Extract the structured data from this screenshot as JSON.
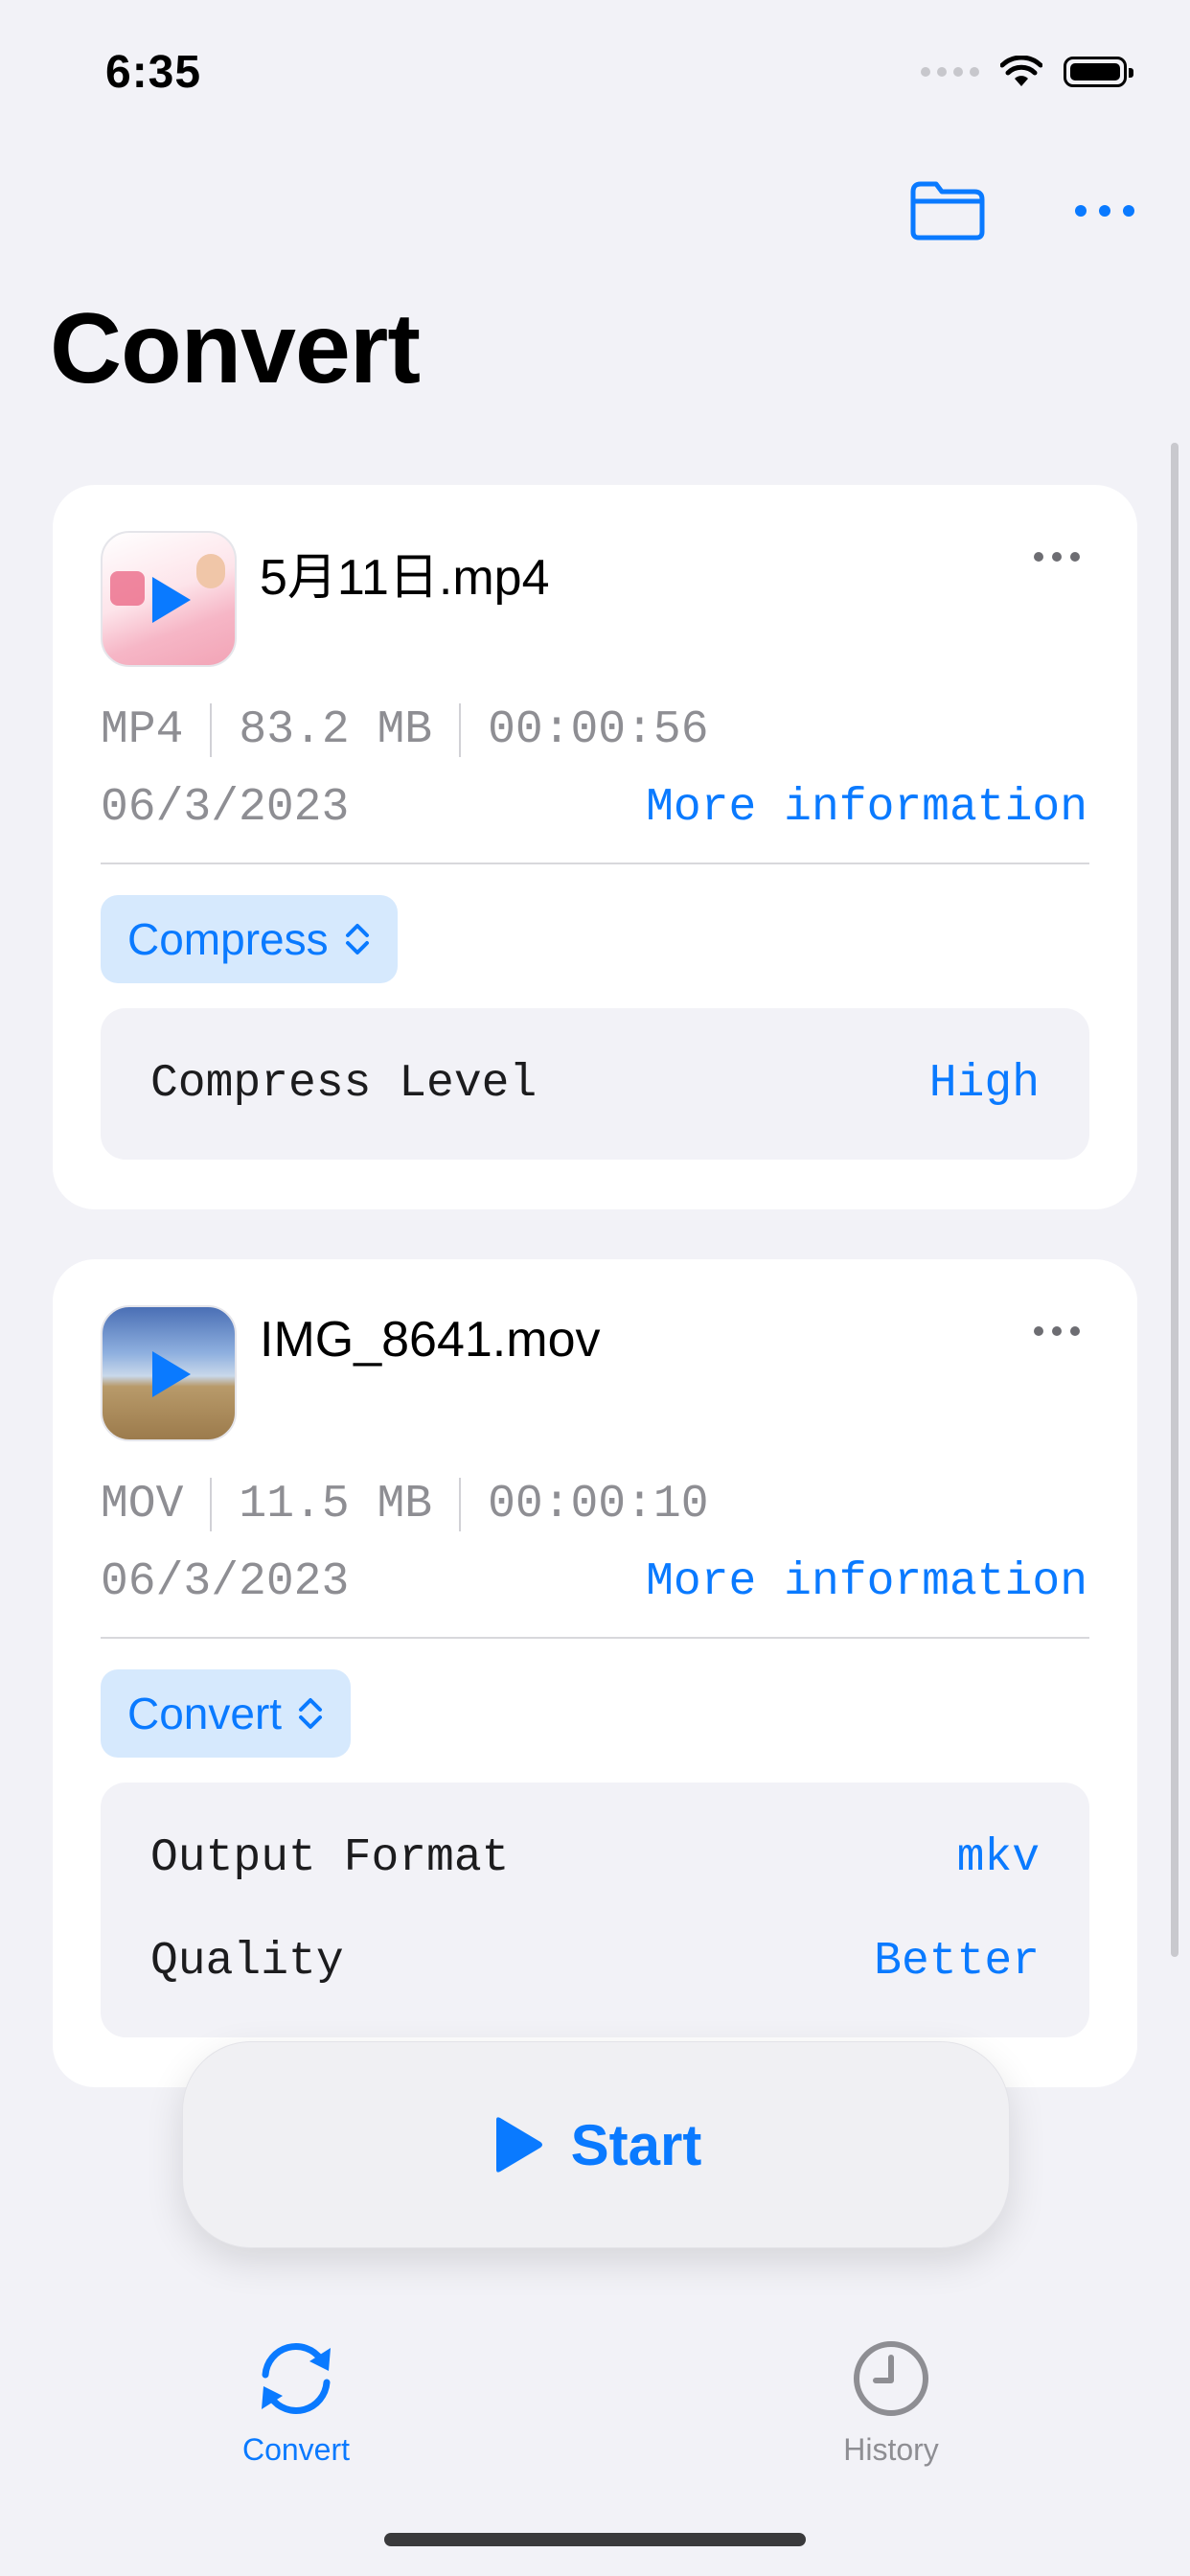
{
  "status": {
    "time": "6:35",
    "wifi_icon": "wifi-icon",
    "battery_icon": "battery-icon"
  },
  "nav": {
    "folder_icon": "folder-icon",
    "more_icon": "ellipsis-icon"
  },
  "page": {
    "title": "Convert"
  },
  "files": [
    {
      "name": "5月11日.mp4",
      "format": "MP4",
      "size": "83.2 MB",
      "duration": "00:00:56",
      "date": "06/3/2023",
      "more_info": "More information",
      "mode": "Compress",
      "options": [
        {
          "label": "Compress Level",
          "value": "High"
        }
      ]
    },
    {
      "name": "IMG_8641.mov",
      "format": "MOV",
      "size": "11.5 MB",
      "duration": "00:00:10",
      "date": "06/3/2023",
      "more_info": "More information",
      "mode": "Convert",
      "options": [
        {
          "label": "Output Format",
          "value": "mkv"
        },
        {
          "label": "Quality",
          "value": "Better"
        }
      ]
    }
  ],
  "start_button": {
    "label": "Start"
  },
  "tabbar": [
    {
      "label": "Convert",
      "icon": "convert-arrows-icon",
      "active": true
    },
    {
      "label": "History",
      "icon": "clock-icon",
      "active": false
    }
  ],
  "colors": {
    "accent": "#0a7aff",
    "background": "#f2f2f7",
    "pill_bg": "#d6e9fd"
  }
}
